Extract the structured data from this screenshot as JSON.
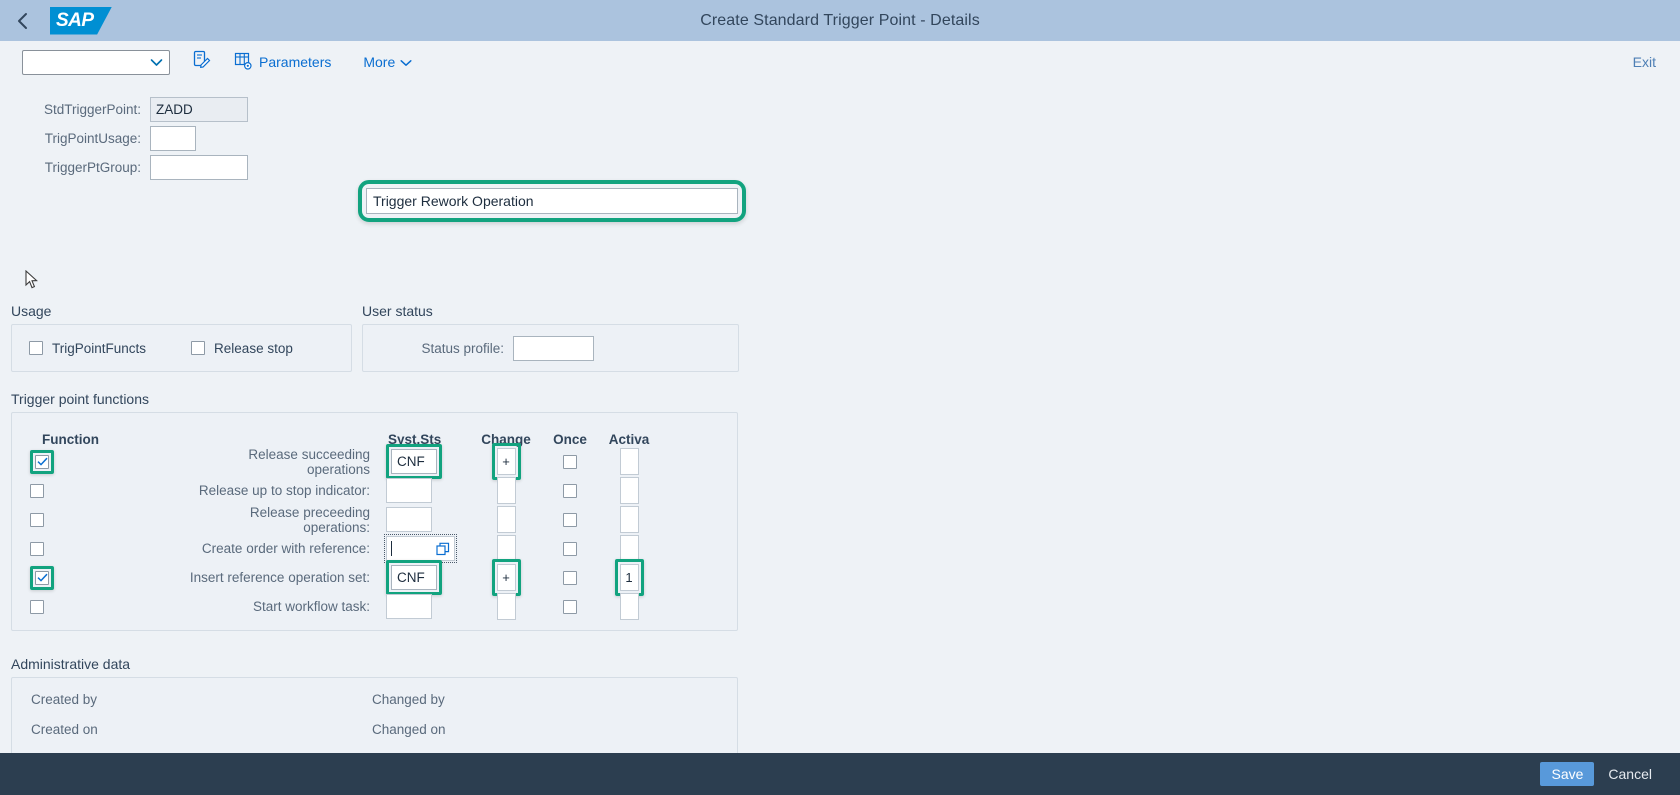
{
  "shell": {
    "title": "Create Standard Trigger Point - Details",
    "back_icon": "chevron-left-icon",
    "logo_text": "SAP"
  },
  "toolbar": {
    "select_value": "",
    "select_icon": "chevron-down-icon",
    "edit_icon": "edit-document-icon",
    "parameters_icon": "table-settings-icon",
    "parameters_label": "Parameters",
    "more_label": "More",
    "more_icon": "chevron-down-icon",
    "exit_label": "Exit"
  },
  "form": {
    "std_trigger_point": {
      "label": "StdTriggerPoint:",
      "value": "ZADD",
      "readonly": true
    },
    "trig_point_usage": {
      "label": "TrigPointUsage:",
      "value": ""
    },
    "trigger_pt_group": {
      "label": "TriggerPtGroup:",
      "value": ""
    },
    "description": {
      "value": "Trigger Rework Operation",
      "highlighted": true
    }
  },
  "usage": {
    "title": "Usage",
    "items": [
      {
        "label": "TrigPointFuncts",
        "checked": false
      },
      {
        "label": "Release stop",
        "checked": false
      }
    ]
  },
  "user_status": {
    "title": "User status",
    "status_profile": {
      "label": "Status profile:",
      "value": ""
    }
  },
  "trigger_point_functions": {
    "title": "Trigger point functions",
    "columns": {
      "function": "Function",
      "label": "",
      "syst_sts": "Syst.Sts",
      "change": "Change",
      "once": "Once",
      "activa": "Activa"
    },
    "rows": [
      {
        "label": "Release succeeding operations",
        "checked": true,
        "check_highlighted": true,
        "syst_sts": "CNF",
        "sts_highlighted": true,
        "change": "+",
        "change_highlighted": true,
        "once": false,
        "activa": "",
        "activa_highlighted": false,
        "focused": false
      },
      {
        "label": "Release up to stop indicator:",
        "checked": false,
        "check_highlighted": false,
        "syst_sts": "",
        "sts_highlighted": false,
        "change": "",
        "change_highlighted": false,
        "once": false,
        "activa": "",
        "activa_highlighted": false,
        "focused": false
      },
      {
        "label": "Release preceeding operations:",
        "checked": false,
        "check_highlighted": false,
        "syst_sts": "",
        "sts_highlighted": false,
        "change": "",
        "change_highlighted": false,
        "once": false,
        "activa": "",
        "activa_highlighted": false,
        "focused": false
      },
      {
        "label": "Create order with reference:",
        "checked": false,
        "check_highlighted": false,
        "syst_sts": "",
        "sts_highlighted": false,
        "change": "",
        "change_highlighted": false,
        "once": false,
        "activa": "",
        "activa_highlighted": false,
        "focused": true,
        "value_help_icon": "value-help-icon"
      },
      {
        "label": "Insert reference operation set:",
        "checked": true,
        "check_highlighted": true,
        "syst_sts": "CNF",
        "sts_highlighted": true,
        "change": "+",
        "change_highlighted": true,
        "once": false,
        "activa": "1",
        "activa_highlighted": true,
        "focused": false
      },
      {
        "label": "Start workflow task:",
        "checked": false,
        "check_highlighted": false,
        "syst_sts": "",
        "sts_highlighted": false,
        "change": "",
        "change_highlighted": false,
        "once": false,
        "activa": "",
        "activa_highlighted": false,
        "focused": false
      }
    ]
  },
  "administrative_data": {
    "title": "Administrative data",
    "created_by_label": "Created by",
    "created_by_value": "",
    "changed_by_label": "Changed by",
    "changed_by_value": "",
    "created_on_label": "Created on",
    "created_on_value": "",
    "changed_on_label": "Changed on",
    "changed_on_value": ""
  },
  "footer": {
    "save_label": "Save",
    "cancel_label": "Cancel"
  },
  "colors": {
    "highlight": "#12a37f",
    "shell_header": "#abc3de",
    "brand_blue": "#008fd3",
    "link": "#0a6ed1",
    "footer_bg": "#2c3e50",
    "save_btn": "#5899da"
  }
}
